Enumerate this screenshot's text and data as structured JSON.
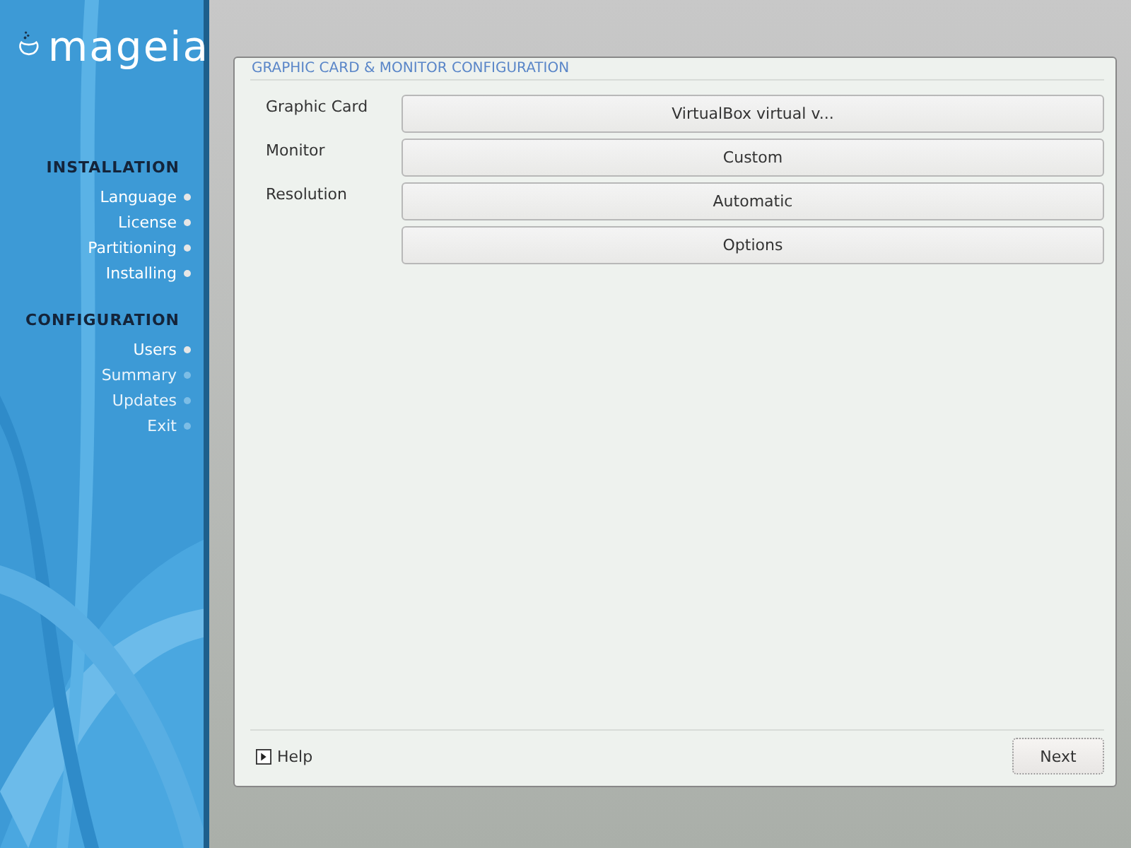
{
  "logo": {
    "text": "mageia"
  },
  "sidebar": {
    "sections": [
      {
        "title": "INSTALLATION",
        "steps": [
          {
            "label": "Language",
            "done": true
          },
          {
            "label": "License",
            "done": true
          },
          {
            "label": "Partitioning",
            "done": true
          },
          {
            "label": "Installing",
            "done": true
          }
        ]
      },
      {
        "title": "CONFIGURATION",
        "steps": [
          {
            "label": "Users",
            "done": true
          },
          {
            "label": "Summary",
            "done": false
          },
          {
            "label": "Updates",
            "done": false
          },
          {
            "label": "Exit",
            "done": false
          }
        ]
      }
    ]
  },
  "panel": {
    "title": "GRAPHIC CARD & MONITOR CONFIGURATION",
    "rows": [
      {
        "label": "Graphic Card",
        "button": "VirtualBox virtual v..."
      },
      {
        "label": "Monitor",
        "button": "Custom"
      },
      {
        "label": "Resolution",
        "button": "Automatic"
      }
    ],
    "options_button": "Options",
    "help": "Help",
    "next_button": "Next"
  }
}
